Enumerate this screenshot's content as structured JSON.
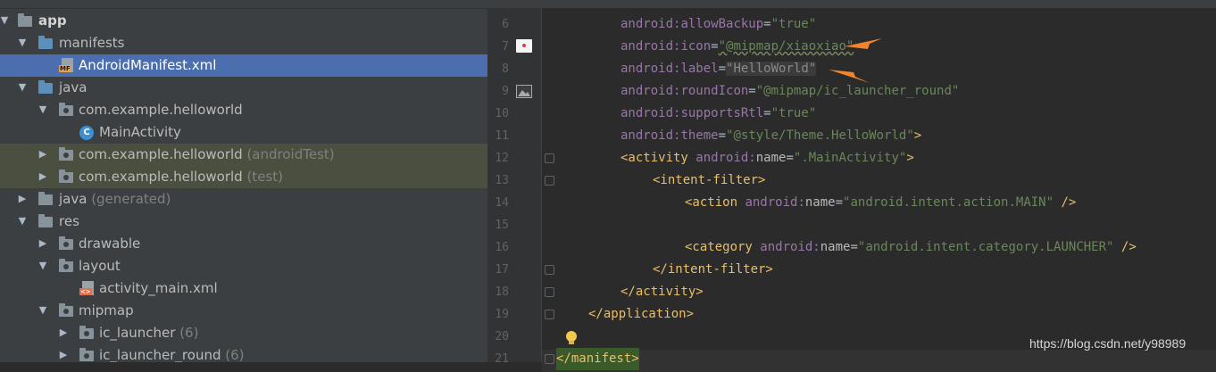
{
  "tree": {
    "items": [
      {
        "label": "app",
        "extra": ""
      },
      {
        "label": "manifests",
        "extra": ""
      },
      {
        "label": "AndroidManifest.xml",
        "extra": "",
        "icon_tag": "MF"
      },
      {
        "label": "java",
        "extra": ""
      },
      {
        "label": "com.example.helloworld",
        "extra": ""
      },
      {
        "label": "MainActivity",
        "extra": "",
        "icon_tag": "C"
      },
      {
        "label": "com.example.helloworld",
        "extra": " (androidTest)"
      },
      {
        "label": "com.example.helloworld",
        "extra": " (test)"
      },
      {
        "label": "java",
        "extra": " (generated)"
      },
      {
        "label": "res",
        "extra": ""
      },
      {
        "label": "drawable",
        "extra": ""
      },
      {
        "label": "layout",
        "extra": ""
      },
      {
        "label": "activity_main.xml",
        "extra": "",
        "icon_tag": "<>"
      },
      {
        "label": "mipmap",
        "extra": ""
      },
      {
        "label": "ic_launcher",
        "extra": " (6)"
      },
      {
        "label": "ic_launcher_round",
        "extra": " (6)"
      }
    ]
  },
  "editor": {
    "line_numbers": [
      "6",
      "7",
      "8",
      "9",
      "10",
      "11",
      "12",
      "13",
      "14",
      "15",
      "16",
      "17",
      "18",
      "19",
      "20",
      "21"
    ],
    "lines": [
      {
        "attr": "android:",
        "name": "allowBackup",
        "eq": "=",
        "val": "\"true\""
      },
      {
        "attr": "android:",
        "name": "icon",
        "eq": "=",
        "val": "\"@mipmap/xiaoxiao\""
      },
      {
        "attr": "android:",
        "name": "label",
        "eq": "=",
        "val": "\"HelloWorld\""
      },
      {
        "attr": "android:",
        "name": "roundIcon",
        "eq": "=",
        "val": "\"@mipmap/ic_launcher_round\""
      },
      {
        "attr": "android:",
        "name": "supportsRtl",
        "eq": "=",
        "val": "\"true\""
      },
      {
        "attr": "android:",
        "name": "theme",
        "eq": "=",
        "val": "\"@style/Theme.HelloWorld\"",
        "close": ">"
      },
      {
        "open": "<activity ",
        "attr": "android:",
        "name": "name",
        "eq": "=",
        "val": "\".MainActivity\"",
        "close": ">"
      },
      {
        "open": "<intent-filter>"
      },
      {
        "open": "<action ",
        "attr": "android:",
        "name": "name",
        "eq": "=",
        "val": "\"android.intent.action.MAIN\"",
        "close": " />"
      },
      {
        "open": ""
      },
      {
        "open": "<category ",
        "attr": "android:",
        "name": "name",
        "eq": "=",
        "val": "\"android.intent.category.LAUNCHER\"",
        "close": " />"
      },
      {
        "open": "</intent-filter>"
      },
      {
        "open": "</activity>"
      },
      {
        "open": "</application>"
      },
      {
        "open": ""
      },
      {
        "open": "</manifest>"
      }
    ]
  },
  "watermark": "https://blog.csdn.net/y98989",
  "colors": {
    "tree_bg": "#3c3f41",
    "selected": "#4b6eaf",
    "editor_bg": "#2b2b2b",
    "attr": "#9876aa",
    "string": "#6a8759",
    "tag": "#e8bf6a",
    "annotation_arrow": "#f0852c"
  }
}
